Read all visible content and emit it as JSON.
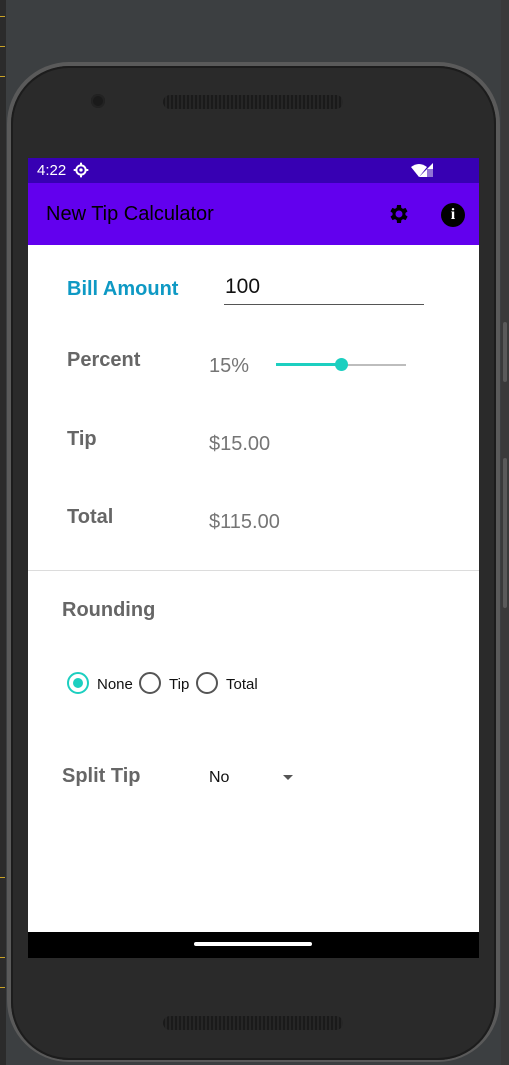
{
  "status_bar": {
    "time": "4:22"
  },
  "app_bar": {
    "title": "New Tip Calculator",
    "settings_icon": "gear-icon",
    "info_icon": "info-icon"
  },
  "bill": {
    "label": "Bill Amount",
    "value": "100"
  },
  "percent": {
    "label": "Percent",
    "value": "15%",
    "slider_fraction": 0.5
  },
  "tip": {
    "label": "Tip",
    "value": "$15.00"
  },
  "total": {
    "label": "Total",
    "value": "$115.00"
  },
  "rounding": {
    "label": "Rounding",
    "options": [
      "None",
      "Tip",
      "Total"
    ],
    "selected": "None"
  },
  "split": {
    "label": "Split Tip",
    "value": "No"
  },
  "colors": {
    "primary": "#6200ee",
    "primary_dark": "#3700b3",
    "accent": "#1ccfc0",
    "label_accent": "#0e99c4"
  }
}
